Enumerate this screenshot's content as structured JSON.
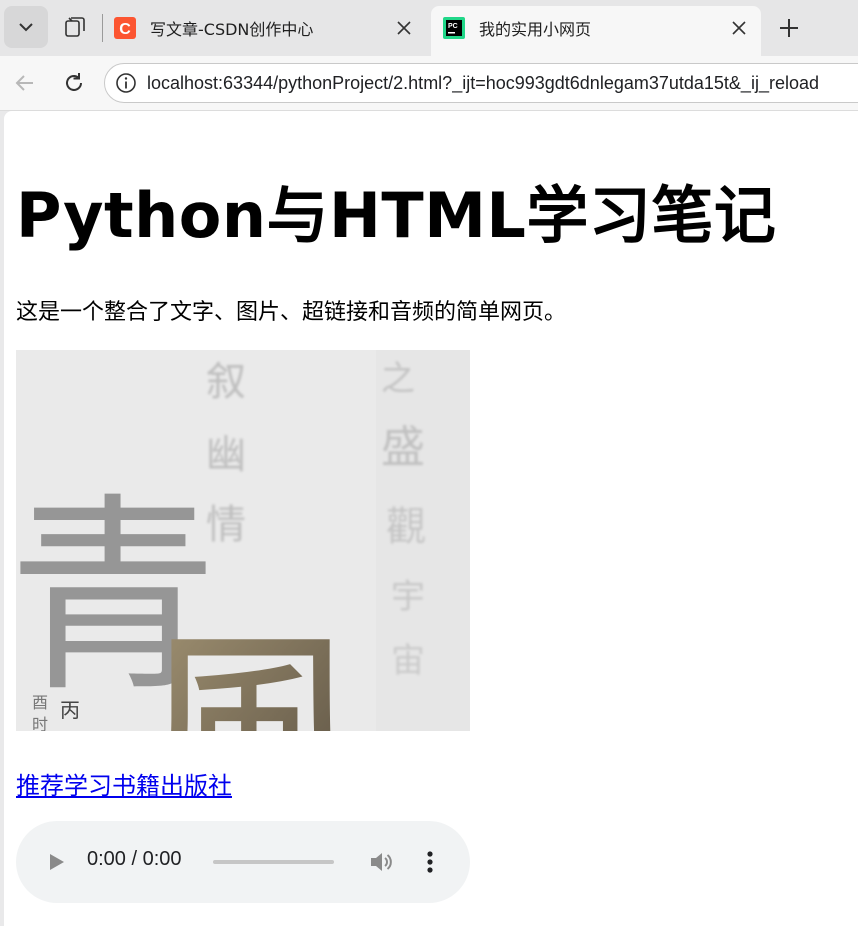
{
  "browser": {
    "tabs": [
      {
        "title": "写文章-CSDN创作中心",
        "favicon": "csdn-logo-icon",
        "active": false
      },
      {
        "title": "我的实用小网页",
        "favicon": "pycharm-logo-icon",
        "active": true
      }
    ],
    "address": {
      "url": "localhost:63344/pythonProject/2.html?_ijt=hoc993gdt6dnlegam37utda15t&_ij_reload"
    },
    "icons": {
      "tab_menu": "chevron-down-icon",
      "collections": "collections-icon",
      "close": "close-icon",
      "new_tab": "plus-icon",
      "back": "back-arrow-icon",
      "reload": "reload-icon",
      "site_info": "info-icon"
    }
  },
  "page": {
    "heading": "Python与HTML学习笔记",
    "intro": "这是一个整合了文字、图片、超链接和音频的简单网页。",
    "image": {
      "description_glyphs": [
        "青",
        "風",
        "叙",
        "幽",
        "情",
        "之",
        "盛",
        "觀",
        "宇",
        "宙",
        "丙",
        "酉",
        "时"
      ]
    },
    "link": {
      "text": "推荐学习书籍出版社"
    },
    "audio": {
      "time": "0:00 / 0:00",
      "progress": 0
    }
  },
  "colors": {
    "link": "#0000ee",
    "csdn_brand": "#fc5531",
    "pycharm_brand": "#21d789",
    "audio_bg": "#f1f3f4"
  }
}
